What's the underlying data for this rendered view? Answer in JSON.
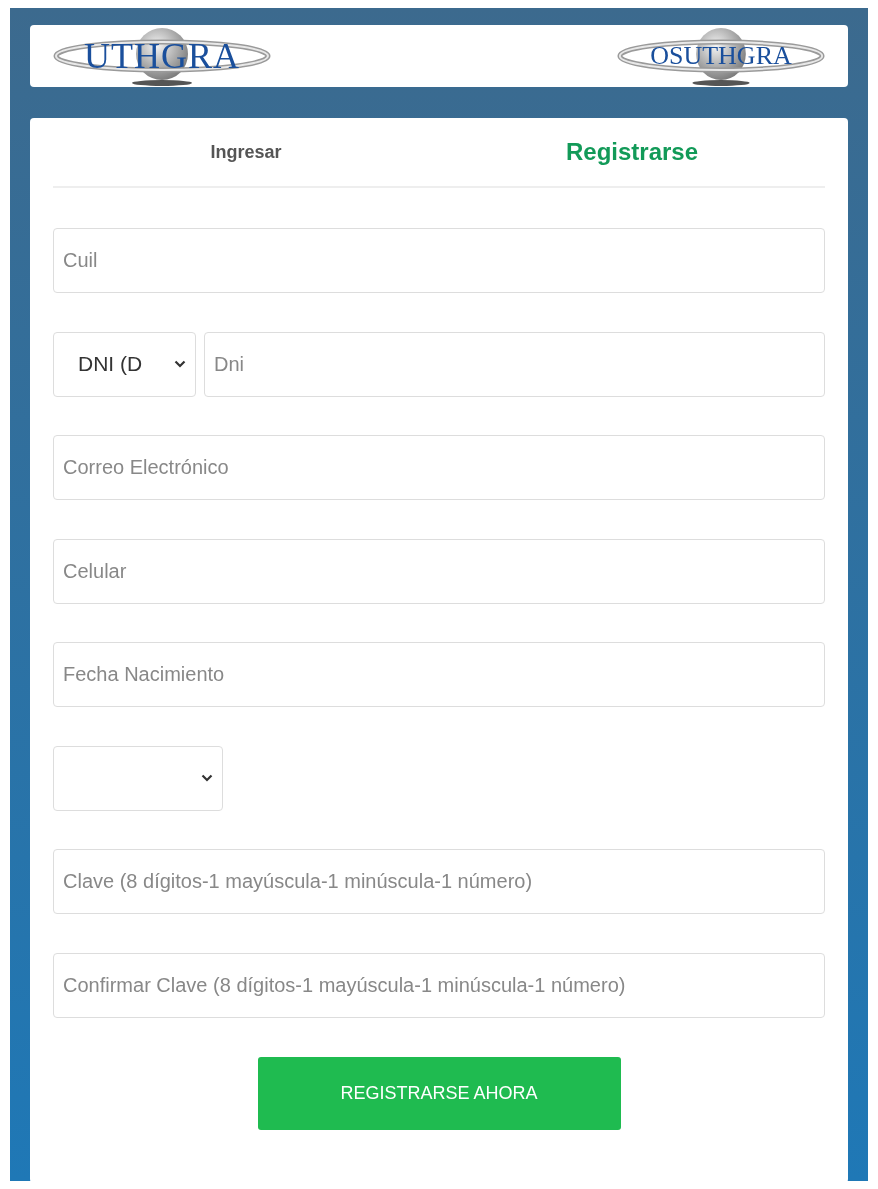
{
  "header": {
    "logos": [
      {
        "text": "UTHGRA"
      },
      {
        "text": "OSUTHGRA"
      }
    ]
  },
  "tabs": [
    {
      "label": "Ingresar",
      "selected": false
    },
    {
      "label": "Registrarse",
      "selected": true
    }
  ],
  "fields": [
    {
      "kind": "input",
      "placeholder": "Cuil"
    },
    {
      "kind": "select_input",
      "value": "DNI (D",
      "placeholder": "Dni"
    },
    {
      "kind": "input",
      "placeholder": "Correo Electrónico"
    },
    {
      "kind": "input",
      "placeholder": "Celular"
    },
    {
      "kind": "input",
      "placeholder": "Fecha Nacimiento"
    },
    {
      "kind": "select"
    },
    {
      "kind": "input",
      "placeholder": "Clave (8 dígitos-1 mayúscula-1 minúscula-1 número)"
    },
    {
      "kind": "input",
      "placeholder": "Confirmar Clave (8 dígitos-1 mayúscula-1 minúscula-1 número)"
    }
  ],
  "submit_button": "REGISTRARSE AHORA"
}
